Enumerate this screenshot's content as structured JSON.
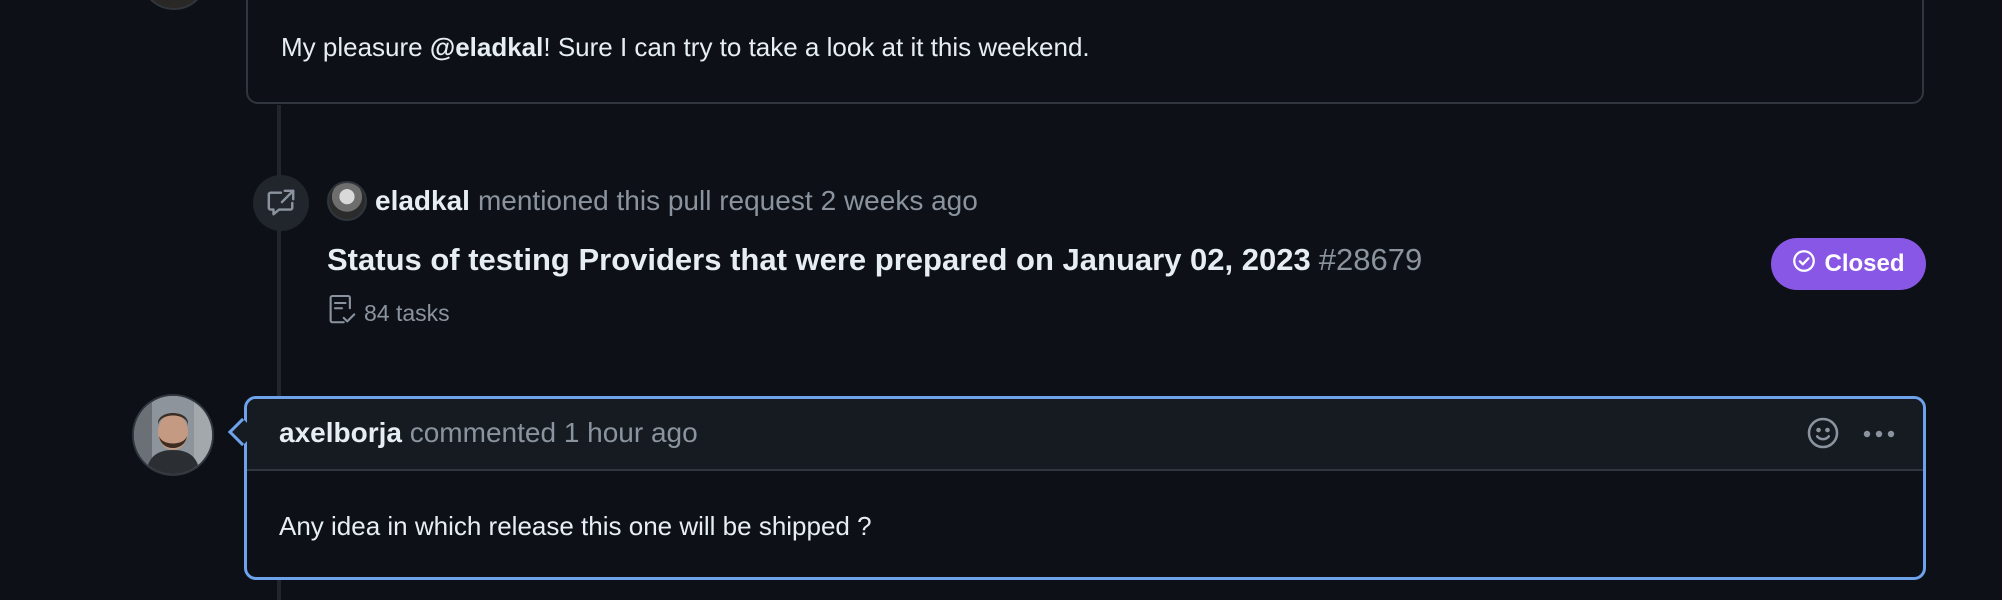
{
  "previous_comment": {
    "body_prefix": "My pleasure ",
    "mention": "@eladkal",
    "body_suffix": "! Sure I can try to take a look at it this weekend."
  },
  "cross_reference": {
    "icon": "cross-reference-icon",
    "author": "eladkal",
    "action": "mentioned this pull request",
    "time": "2 weeks ago",
    "issue_title": "Status of testing Providers that were prepared on January 02, 2023",
    "issue_number": "#28679",
    "tasks_label": "84 tasks",
    "state_label": "Closed",
    "state_color": "#8957e5"
  },
  "comment": {
    "author": "axelborja",
    "action": "commented",
    "time": "1 hour ago",
    "body": "Any idea in which release this one will be shipped ?",
    "highlight_color": "#6ea2eb",
    "icons": [
      "smiley-icon",
      "kebab-horizontal-icon"
    ]
  }
}
